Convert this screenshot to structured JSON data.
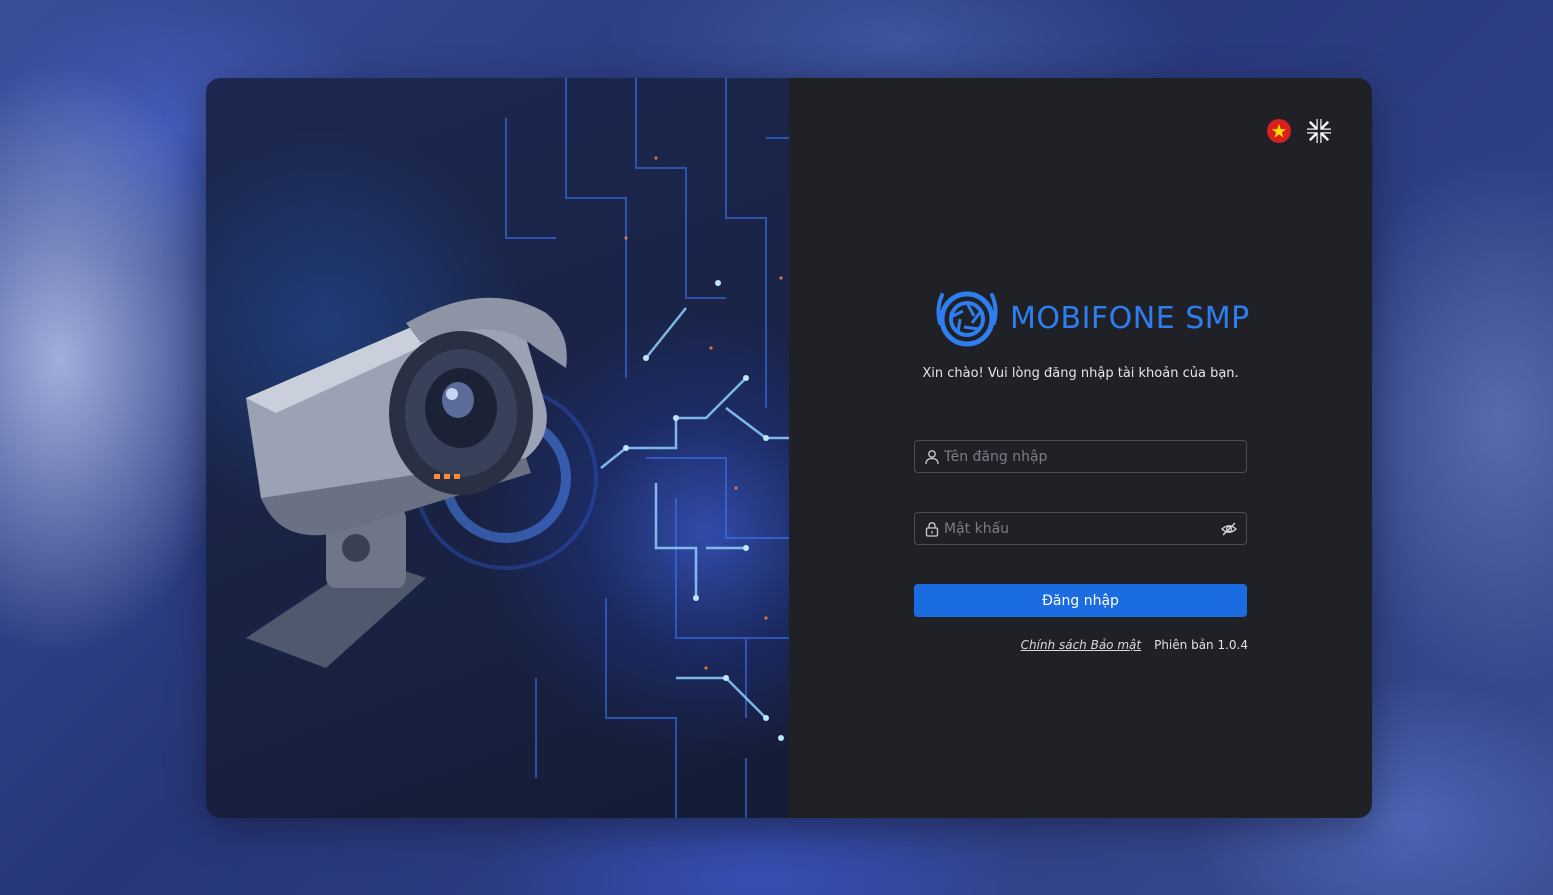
{
  "brand": {
    "name": "MOBIFONE SMP",
    "color": "#2e7ef0"
  },
  "greeting": "Xin chào! Vui lòng đăng nhập tài khoản của bạn.",
  "languages": [
    {
      "code": "vi",
      "icon": "vietnam-flag-icon"
    },
    {
      "code": "en",
      "icon": "uk-flag-icon"
    }
  ],
  "form": {
    "username": {
      "value": "",
      "placeholder": "Tên đăng nhập",
      "icon": "user-icon"
    },
    "password": {
      "value": "",
      "placeholder": "Mật khẩu",
      "icon": "lock-icon",
      "toggle_icon": "eye-off-icon"
    },
    "submit_label": "Đăng nhập",
    "submit_color": "#1a6ce0"
  },
  "footer": {
    "privacy_link": "Chính sách Bảo mật",
    "version": "Phiên bản 1.0.4"
  }
}
